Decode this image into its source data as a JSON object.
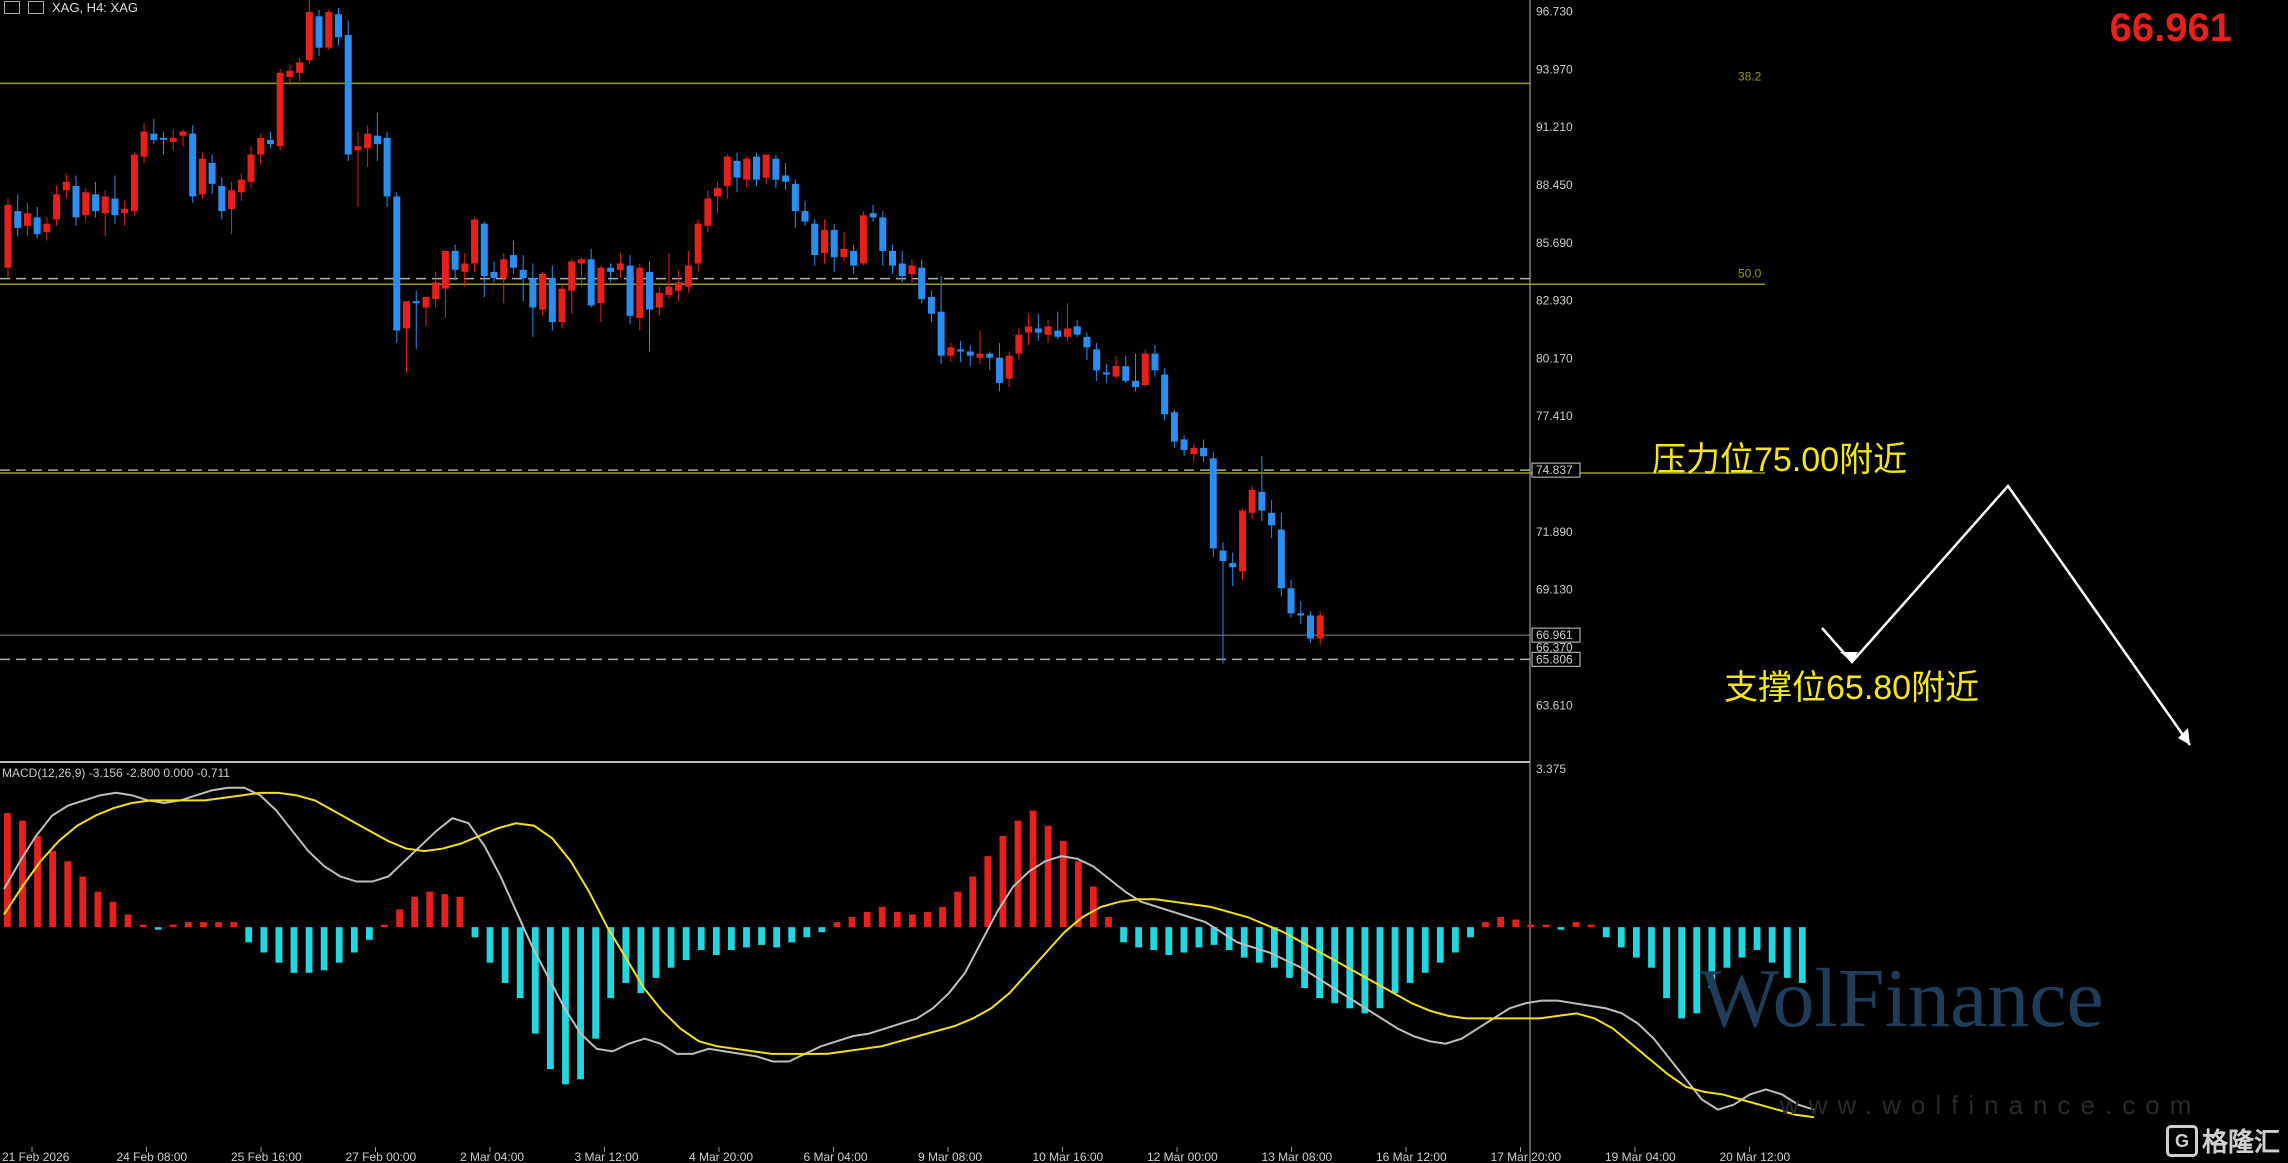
{
  "header": {
    "symbol_label": "XAG, H4:  XAG",
    "current_price": "66.961"
  },
  "price_axis": {
    "min": 61.0,
    "max": 96.8,
    "ticks": [
      "96.730",
      "93.970",
      "91.210",
      "88.450",
      "85.690",
      "82.930",
      "80.170",
      "77.410",
      "74.837",
      "71.890",
      "69.130",
      "66.961",
      "66.370",
      "65.806",
      "63.610"
    ]
  },
  "price_levels": {
    "fib_382": 93.3,
    "fib_382_label": "38.2",
    "fib_50": 83.9,
    "fib_50_label": "50.0",
    "dashed": [
      83.975,
      74.837,
      65.806
    ],
    "current": 66.961,
    "box_labels": [
      "83.975",
      "74.837",
      "66.961",
      "65.806"
    ]
  },
  "time_axis": [
    "21 Feb 2026",
    "24 Feb 08:00",
    "25 Feb 16:00",
    "27 Feb 00:00",
    "2 Mar 04:00",
    "3 Mar 12:00",
    "4 Mar 20:00",
    "6 Mar 04:00",
    "9 Mar 08:00",
    "10 Mar 16:00",
    "12 Mar 00:00",
    "13 Mar 08:00",
    "16 Mar 12:00",
    "17 Mar 20:00",
    "19 Mar 04:00",
    "20 Mar 12:00"
  ],
  "annotations": {
    "resistance": "压力位75.00附近",
    "support": "支撑位65.80附近"
  },
  "macd": {
    "label": "MACD(12,26,9) -3.156 -2.800 0.000 -0.711",
    "axis_top": "3.375",
    "histogram": [
      4.5,
      4.2,
      3.6,
      3.0,
      2.6,
      2.0,
      1.4,
      1.0,
      0.5,
      0.1,
      -0.1,
      0.1,
      0.2,
      0.2,
      0.2,
      0.2,
      -0.6,
      -1.0,
      -1.4,
      -1.8,
      -1.8,
      -1.7,
      -1.4,
      -1.0,
      -0.5,
      0.1,
      0.7,
      1.2,
      1.4,
      1.3,
      1.2,
      -0.4,
      -1.4,
      -2.2,
      -2.8,
      -4.2,
      -5.6,
      -6.2,
      -6.0,
      -4.4,
      -2.8,
      -2.2,
      -2.6,
      -2.0,
      -1.6,
      -1.3,
      -0.9,
      -1.1,
      -0.9,
      -0.8,
      -0.7,
      -0.8,
      -0.6,
      -0.4,
      -0.2,
      0.2,
      0.4,
      0.6,
      0.8,
      0.6,
      0.5,
      0.6,
      0.8,
      1.4,
      2.0,
      2.8,
      3.6,
      4.2,
      4.6,
      4.0,
      3.4,
      2.6,
      1.6,
      0.4,
      -0.6,
      -0.8,
      -0.9,
      -1.1,
      -1.0,
      -0.8,
      -0.7,
      -0.9,
      -1.2,
      -1.4,
      -1.6,
      -2.0,
      -2.4,
      -2.8,
      -3.0,
      -3.2,
      -3.4,
      -3.2,
      -2.6,
      -2.2,
      -1.8,
      -1.4,
      -1.0,
      -0.4,
      0.2,
      0.4,
      0.3,
      0.1,
      0.1,
      -0.1,
      0.2,
      0.1,
      -0.4,
      -0.8,
      -1.2,
      -1.6,
      -2.8,
      -3.6,
      -3.4,
      -2.4,
      -1.6,
      -1.2,
      -0.9,
      -1.4,
      -2.0,
      -2.2
    ],
    "macd_line": [
      1.5,
      2.6,
      3.6,
      4.4,
      4.8,
      5.0,
      5.2,
      5.3,
      5.2,
      5.0,
      4.9,
      5.0,
      5.2,
      5.4,
      5.5,
      5.5,
      5.2,
      4.6,
      3.8,
      3.0,
      2.4,
      2.0,
      1.8,
      1.8,
      2.0,
      2.6,
      3.2,
      3.8,
      4.3,
      4.1,
      3.2,
      2.0,
      0.6,
      -0.8,
      -2.0,
      -3.2,
      -4.2,
      -4.8,
      -4.9,
      -4.6,
      -4.4,
      -4.6,
      -5.0,
      -5.0,
      -4.8,
      -4.9,
      -5.0,
      -5.1,
      -5.3,
      -5.3,
      -5.0,
      -4.7,
      -4.5,
      -4.3,
      -4.2,
      -4.0,
      -3.8,
      -3.6,
      -3.2,
      -2.6,
      -1.8,
      -0.6,
      0.6,
      1.6,
      2.2,
      2.6,
      2.8,
      2.7,
      2.4,
      1.9,
      1.4,
      1.0,
      0.8,
      0.6,
      0.4,
      0.2,
      -0.2,
      -0.6,
      -0.8,
      -1.0,
      -1.3,
      -1.6,
      -2.0,
      -2.4,
      -2.8,
      -3.2,
      -3.6,
      -4.0,
      -4.3,
      -4.5,
      -4.6,
      -4.4,
      -4.0,
      -3.6,
      -3.2,
      -3.0,
      -2.9,
      -2.9,
      -3.0,
      -3.1,
      -3.2,
      -3.4,
      -3.8,
      -4.4,
      -5.2,
      -6.0,
      -6.8,
      -7.2,
      -7.0,
      -6.6,
      -6.4,
      -6.6,
      -7.0,
      -7.2
    ],
    "signal_line": [
      0.5,
      1.6,
      2.6,
      3.4,
      4.0,
      4.4,
      4.7,
      4.9,
      5.0,
      5.0,
      5.0,
      5.0,
      5.1,
      5.2,
      5.3,
      5.3,
      5.2,
      5.0,
      4.6,
      4.2,
      3.8,
      3.4,
      3.1,
      3.0,
      3.1,
      3.3,
      3.6,
      3.9,
      4.1,
      4.0,
      3.5,
      2.6,
      1.4,
      0.0,
      -1.2,
      -2.4,
      -3.3,
      -4.0,
      -4.5,
      -4.7,
      -4.8,
      -4.9,
      -5.0,
      -5.0,
      -5.0,
      -5.0,
      -4.9,
      -4.8,
      -4.7,
      -4.5,
      -4.3,
      -4.1,
      -3.9,
      -3.6,
      -3.2,
      -2.6,
      -1.8,
      -1.0,
      -0.2,
      0.4,
      0.8,
      1.0,
      1.1,
      1.1,
      1.0,
      0.9,
      0.8,
      0.6,
      0.4,
      0.1,
      -0.2,
      -0.6,
      -1.0,
      -1.4,
      -1.8,
      -2.2,
      -2.6,
      -3.0,
      -3.3,
      -3.5,
      -3.6,
      -3.6,
      -3.6,
      -3.6,
      -3.6,
      -3.5,
      -3.4,
      -3.6,
      -4.0,
      -4.6,
      -5.2,
      -5.8,
      -6.3,
      -6.5,
      -6.6,
      -6.8,
      -7.0,
      -7.2,
      -7.4,
      -7.5
    ],
    "range": [
      -8.2,
      6.2
    ]
  },
  "candles": [
    [
      84.5,
      87.8,
      84.0,
      87.5
    ],
    [
      87.2,
      88.0,
      86.0,
      86.4
    ],
    [
      86.5,
      87.6,
      86.0,
      87.1
    ],
    [
      86.9,
      87.4,
      85.9,
      86.1
    ],
    [
      86.2,
      86.9,
      85.8,
      86.6
    ],
    [
      86.8,
      88.4,
      86.5,
      88.0
    ],
    [
      88.2,
      89.0,
      87.8,
      88.6
    ],
    [
      88.4,
      88.9,
      86.5,
      86.9
    ],
    [
      87.0,
      88.3,
      86.7,
      88.1
    ],
    [
      88.0,
      88.6,
      86.9,
      87.2
    ],
    [
      87.1,
      88.2,
      86.0,
      87.9
    ],
    [
      87.8,
      88.9,
      86.6,
      87.0
    ],
    [
      87.1,
      87.7,
      86.5,
      87.3
    ],
    [
      87.2,
      90.0,
      87.0,
      89.9
    ],
    [
      89.8,
      91.4,
      89.5,
      91.0
    ],
    [
      90.9,
      91.6,
      90.4,
      90.6
    ],
    [
      90.7,
      91.0,
      89.9,
      90.6
    ],
    [
      90.5,
      91.1,
      90.1,
      90.7
    ],
    [
      90.8,
      91.1,
      90.3,
      91.0
    ],
    [
      90.9,
      91.3,
      87.6,
      87.9
    ],
    [
      88.0,
      90.0,
      87.8,
      89.7
    ],
    [
      89.5,
      89.9,
      88.0,
      88.5
    ],
    [
      88.4,
      88.8,
      86.8,
      87.2
    ],
    [
      87.3,
      88.6,
      86.1,
      88.2
    ],
    [
      88.1,
      89.0,
      87.7,
      88.7
    ],
    [
      88.6,
      90.3,
      88.3,
      89.9
    ],
    [
      89.9,
      90.9,
      89.4,
      90.7
    ],
    [
      90.6,
      91.0,
      90.2,
      90.4
    ],
    [
      90.3,
      94.0,
      90.1,
      93.8
    ],
    [
      93.6,
      94.2,
      93.2,
      93.9
    ],
    [
      93.8,
      94.5,
      93.4,
      94.3
    ],
    [
      94.4,
      97.5,
      94.2,
      96.7
    ],
    [
      96.5,
      96.8,
      94.6,
      95.0
    ],
    [
      95.0,
      96.8,
      94.9,
      96.7
    ],
    [
      96.6,
      96.9,
      95.1,
      95.5
    ],
    [
      95.6,
      96.3,
      89.6,
      89.9
    ],
    [
      90.1,
      91.0,
      87.4,
      90.3
    ],
    [
      90.2,
      91.3,
      89.3,
      90.9
    ],
    [
      90.8,
      91.9,
      89.6,
      90.4
    ],
    [
      90.7,
      91.0,
      87.4,
      87.9
    ],
    [
      87.9,
      88.1,
      80.9,
      81.5
    ],
    [
      81.6,
      82.6,
      79.5,
      82.9
    ],
    [
      82.9,
      83.4,
      80.6,
      82.8
    ],
    [
      82.6,
      83.1,
      81.7,
      83.1
    ],
    [
      83.0,
      84.3,
      82.6,
      83.8
    ],
    [
      83.5,
      85.1,
      82.1,
      85.3
    ],
    [
      85.3,
      85.6,
      83.9,
      84.4
    ],
    [
      84.3,
      85.2,
      83.6,
      84.7
    ],
    [
      84.7,
      86.9,
      84.3,
      86.8
    ],
    [
      86.6,
      86.7,
      83.1,
      84.1
    ],
    [
      84.3,
      84.8,
      83.8,
      84.0
    ],
    [
      84.0,
      85.2,
      82.8,
      84.9
    ],
    [
      85.1,
      85.8,
      84.2,
      84.5
    ],
    [
      84.4,
      85.1,
      82.9,
      84.0
    ],
    [
      84.0,
      84.7,
      81.2,
      82.6
    ],
    [
      82.5,
      84.3,
      82.2,
      84.2
    ],
    [
      84.0,
      84.6,
      81.5,
      81.9
    ],
    [
      81.9,
      83.7,
      81.6,
      83.5
    ],
    [
      83.4,
      84.9,
      82.3,
      84.8
    ],
    [
      84.7,
      85.0,
      83.6,
      84.9
    ],
    [
      84.9,
      85.4,
      82.6,
      82.7
    ],
    [
      82.8,
      84.6,
      81.9,
      84.5
    ],
    [
      84.5,
      84.7,
      83.8,
      84.3
    ],
    [
      84.4,
      85.2,
      84.0,
      84.7
    ],
    [
      84.6,
      85.1,
      81.8,
      82.2
    ],
    [
      82.1,
      84.7,
      81.5,
      84.5
    ],
    [
      84.3,
      84.8,
      80.5,
      82.5
    ],
    [
      82.6,
      83.6,
      82.2,
      83.3
    ],
    [
      83.2,
      85.2,
      83.0,
      83.6
    ],
    [
      83.4,
      84.4,
      82.9,
      83.8
    ],
    [
      83.6,
      85.3,
      83.3,
      84.6
    ],
    [
      84.7,
      86.8,
      84.3,
      86.6
    ],
    [
      86.5,
      88.2,
      86.2,
      87.8
    ],
    [
      87.9,
      88.6,
      87.1,
      88.3
    ],
    [
      88.4,
      89.9,
      87.8,
      89.8
    ],
    [
      89.6,
      90.0,
      88.1,
      88.8
    ],
    [
      88.7,
      89.8,
      88.3,
      89.7
    ],
    [
      89.8,
      90.0,
      88.4,
      88.7
    ],
    [
      88.8,
      89.9,
      88.5,
      89.9
    ],
    [
      89.7,
      89.9,
      88.3,
      88.7
    ],
    [
      88.9,
      89.5,
      88.2,
      88.6
    ],
    [
      88.5,
      88.7,
      86.4,
      87.2
    ],
    [
      87.2,
      87.7,
      86.5,
      86.7
    ],
    [
      86.6,
      86.8,
      84.6,
      85.1
    ],
    [
      85.2,
      86.8,
      84.7,
      86.3
    ],
    [
      86.3,
      86.6,
      84.3,
      85.0
    ],
    [
      85.0,
      86.2,
      84.8,
      85.4
    ],
    [
      85.3,
      85.6,
      84.2,
      84.6
    ],
    [
      84.7,
      87.2,
      84.6,
      87.0
    ],
    [
      87.1,
      87.5,
      86.7,
      86.9
    ],
    [
      86.9,
      87.2,
      84.6,
      85.3
    ],
    [
      85.3,
      85.6,
      84.2,
      84.6
    ],
    [
      84.7,
      85.3,
      83.8,
      84.1
    ],
    [
      84.2,
      84.9,
      83.8,
      84.6
    ],
    [
      84.5,
      84.9,
      82.8,
      83.0
    ],
    [
      83.1,
      83.4,
      81.9,
      82.3
    ],
    [
      82.4,
      84.1,
      79.9,
      80.3
    ],
    [
      80.3,
      80.9,
      80.0,
      80.7
    ],
    [
      80.6,
      81.0,
      80.0,
      80.5
    ],
    [
      80.5,
      80.8,
      79.8,
      80.3
    ],
    [
      80.2,
      81.5,
      79.9,
      80.4
    ],
    [
      80.4,
      80.5,
      79.6,
      80.2
    ],
    [
      80.2,
      80.9,
      78.6,
      79.0
    ],
    [
      79.2,
      80.5,
      78.8,
      80.3
    ],
    [
      80.4,
      81.6,
      80.1,
      81.3
    ],
    [
      81.4,
      82.3,
      80.8,
      81.7
    ],
    [
      81.6,
      82.3,
      81.0,
      81.4
    ],
    [
      81.3,
      82.0,
      80.9,
      81.7
    ],
    [
      81.5,
      82.4,
      81.1,
      81.2
    ],
    [
      81.2,
      82.8,
      81.0,
      81.6
    ],
    [
      81.7,
      82.0,
      81.2,
      81.3
    ],
    [
      81.2,
      81.4,
      80.1,
      80.7
    ],
    [
      80.6,
      80.9,
      79.1,
      79.6
    ],
    [
      79.5,
      79.9,
      79.0,
      79.4
    ],
    [
      79.3,
      80.3,
      79.2,
      79.8
    ],
    [
      79.8,
      80.3,
      79.0,
      79.1
    ],
    [
      79.1,
      80.4,
      78.6,
      78.8
    ],
    [
      78.9,
      80.6,
      78.8,
      80.4
    ],
    [
      80.4,
      80.8,
      79.3,
      79.6
    ],
    [
      79.4,
      79.7,
      77.2,
      77.5
    ],
    [
      77.6,
      77.7,
      75.9,
      76.2
    ],
    [
      76.3,
      76.5,
      75.5,
      75.8
    ],
    [
      75.6,
      76.1,
      75.2,
      75.9
    ],
    [
      75.9,
      76.3,
      75.2,
      75.5
    ],
    [
      75.4,
      75.7,
      70.7,
      71.1
    ],
    [
      71.0,
      71.4,
      65.6,
      70.5
    ],
    [
      70.4,
      70.9,
      69.3,
      70.2
    ],
    [
      70.0,
      73.0,
      69.6,
      72.9
    ],
    [
      72.8,
      74.1,
      72.5,
      73.9
    ],
    [
      73.8,
      75.5,
      72.4,
      72.9
    ],
    [
      72.8,
      73.4,
      71.6,
      72.2
    ],
    [
      72.0,
      72.8,
      68.8,
      69.2
    ],
    [
      69.2,
      69.6,
      67.8,
      68.0
    ],
    [
      68.0,
      68.6,
      67.5,
      67.9
    ],
    [
      67.9,
      68.1,
      66.6,
      66.8
    ],
    [
      66.8,
      68.1,
      66.5,
      67.9
    ]
  ]
}
